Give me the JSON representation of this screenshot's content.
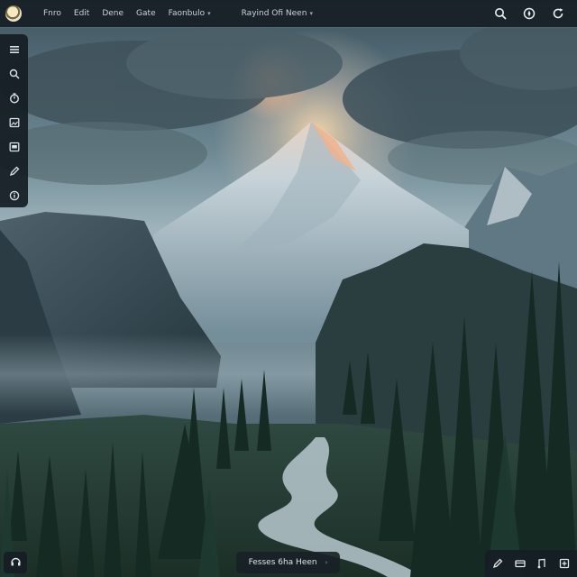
{
  "app": {
    "menu": [
      {
        "label": "Fnro",
        "has_caret": false
      },
      {
        "label": "Edit",
        "has_caret": false
      },
      {
        "label": "Dene",
        "has_caret": false
      },
      {
        "label": "Gate",
        "has_caret": false
      },
      {
        "label": "Faonbulo",
        "has_caret": true
      }
    ],
    "workspace_label": "Rayind Ofi Neen",
    "right_icons": [
      "search-icon",
      "compass-icon",
      "refresh-icon"
    ]
  },
  "left_toolbar": {
    "tools": [
      "layers-icon",
      "search-icon",
      "timer-icon",
      "image-icon",
      "gallery-icon",
      "pen-icon",
      "info-icon"
    ]
  },
  "bottom": {
    "left_icon": "headphones-icon",
    "center_label": "Fesses 6ha Heen",
    "right_icons": [
      "layout-icon",
      "stack-icon",
      "note-icon",
      "export-icon"
    ]
  },
  "scene": {
    "subject": "mountain-landscape"
  }
}
